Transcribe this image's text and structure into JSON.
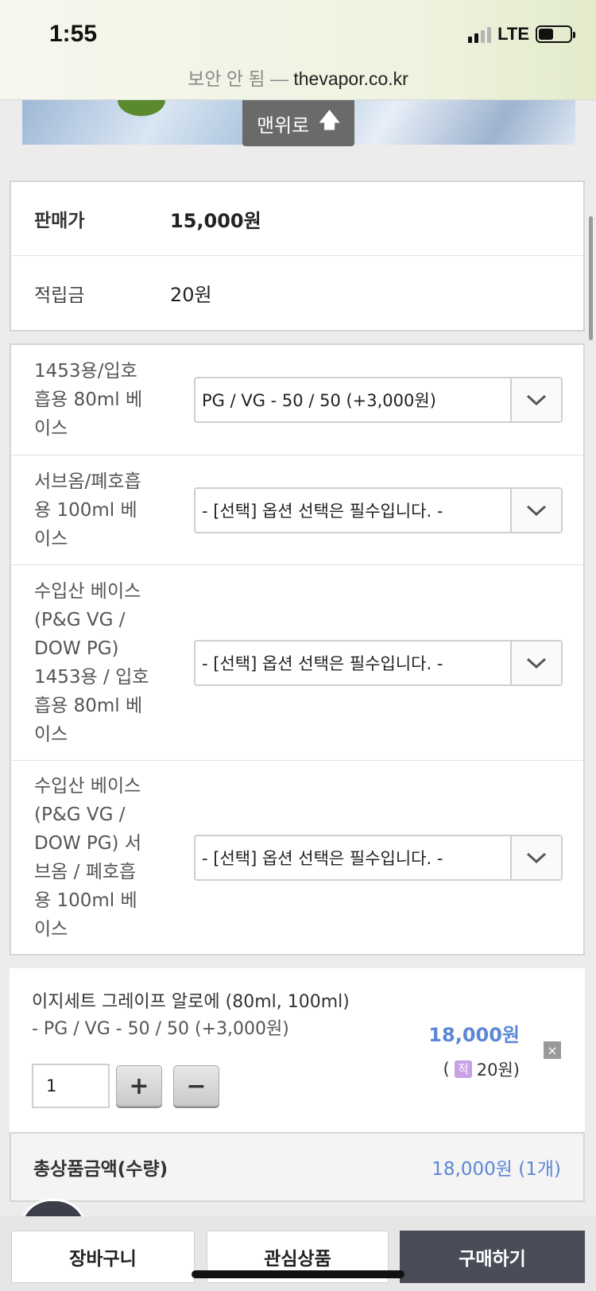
{
  "status_bar": {
    "time": "1:55",
    "network": "LTE"
  },
  "url_bar": {
    "insecure_label": "보안 안 됨 —",
    "domain": "thevapor.co.kr"
  },
  "scroll_top_button": {
    "label": "맨위로"
  },
  "price_info": {
    "sale_price_label": "판매가",
    "sale_price_value": "15,000원",
    "reward_label": "적립금",
    "reward_value": "20원"
  },
  "options": [
    {
      "label": "1453용/입호흡용 80ml 베이스",
      "label_lines": [
        "1453용/입호",
        "흡용 80ml 베",
        "이스"
      ],
      "selected": "PG / VG - 50 / 50 (+3,000원)"
    },
    {
      "label": "서브옴/폐호흡용 100ml 베이스",
      "label_lines": [
        "서브옴/폐호흡",
        "용 100ml 베",
        "이스"
      ],
      "selected": "- [선택] 옵션 선택은 필수입니다. -"
    },
    {
      "label": "수입산 베이스 (P&G VG / DOW PG) 1453용 / 입호흡용 80ml 베이스",
      "label_lines": [
        "수입산 베이스",
        "(P&G VG /",
        "DOW PG)",
        "1453용 / 입호",
        "흡용 80ml 베",
        "이스"
      ],
      "selected": "- [선택] 옵션 선택은 필수입니다. -"
    },
    {
      "label": "수입산 베이스 (P&G VG / DOW PG) 서브옴 / 폐호흡용 100ml 베이스",
      "label_lines": [
        "수입산 베이스",
        "(P&G VG /",
        "DOW PG) 서",
        "브옴 / 폐호흡",
        "용 100ml 베",
        "이스"
      ],
      "selected": "- [선택] 옵션 선택은 필수입니다. -"
    }
  ],
  "selected_item": {
    "name": "이지세트 그레이프 알로에 (80ml, 100ml)",
    "option": "- PG / VG - 50 / 50 (+3,000원)",
    "price": "18,000원",
    "reward_open": "(",
    "reward_badge": "적",
    "reward_amount": "20원)",
    "quantity": "1",
    "plus_label": "+",
    "minus_label": "−",
    "close_label": "×"
  },
  "total": {
    "label": "총상품금액(수량)",
    "value": "18,000원 (1개)"
  },
  "actions": {
    "cart": "장바구니",
    "wishlist": "관심상품",
    "buy": "구매하기"
  },
  "colors": {
    "accent_blue": "#5b87d6",
    "buy_button": "#4a4d57",
    "reward_badge": "#c7a0e6"
  }
}
